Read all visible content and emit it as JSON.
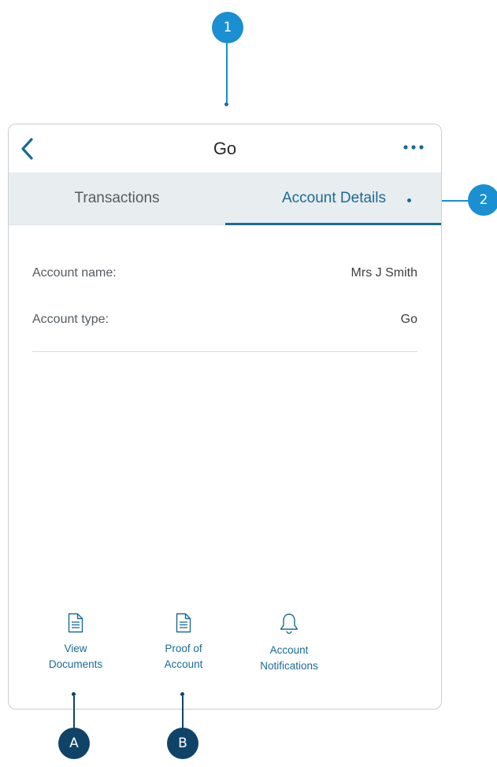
{
  "callouts": {
    "c1": "1",
    "c2": "2",
    "cA": "A",
    "cB": "B"
  },
  "header": {
    "title": "Go",
    "back_icon": "chevron-left-icon",
    "more_icon": "ellipsis-icon"
  },
  "tabs": [
    {
      "label": "Transactions",
      "active": false
    },
    {
      "label": "Account Details",
      "active": true
    }
  ],
  "details": [
    {
      "label": "Account name:",
      "value": "Mrs J Smith"
    },
    {
      "label": "Account type:",
      "value": "Go"
    }
  ],
  "actions": [
    {
      "line1": "View",
      "line2": "Documents",
      "icon": "document-icon"
    },
    {
      "line1": "Proof of",
      "line2": "Account",
      "icon": "document-icon"
    },
    {
      "line1": "Account",
      "line2": "Notifications",
      "icon": "bell-icon"
    }
  ],
  "colors": {
    "accent": "#1b6a94",
    "callout_light": "#1a8fd1",
    "callout_dark": "#0f4468",
    "tab_bar": "#e8edf0"
  }
}
